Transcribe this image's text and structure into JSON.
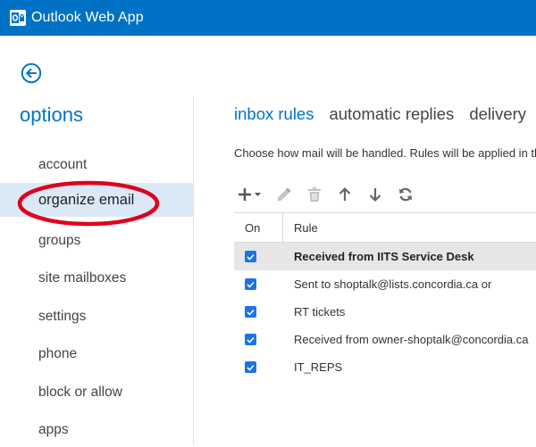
{
  "app": {
    "title": "Outlook Web App"
  },
  "sidebar": {
    "title": "options",
    "items": [
      {
        "label": "account"
      },
      {
        "label": "organize email",
        "selected": true
      },
      {
        "label": "groups"
      },
      {
        "label": "site mailboxes"
      },
      {
        "label": "settings"
      },
      {
        "label": "phone"
      },
      {
        "label": "block or allow"
      },
      {
        "label": "apps"
      }
    ]
  },
  "tabs": [
    {
      "label": "inbox rules",
      "active": true
    },
    {
      "label": "automatic replies"
    },
    {
      "label": "delivery"
    }
  ],
  "description": "Choose how mail will be handled. Rules will be applied in th",
  "toolbar": {
    "icons": [
      "add-icon",
      "edit-icon",
      "delete-icon",
      "move-up-icon",
      "move-down-icon",
      "refresh-icon"
    ]
  },
  "rules_table": {
    "columns": [
      "On",
      "Rule"
    ],
    "rows": [
      {
        "name": "Received from IITS Service Desk",
        "on": true,
        "selected": true
      },
      {
        "name": "Sent to shoptalk@lists.concordia.ca or",
        "on": true
      },
      {
        "name": "RT tickets",
        "on": true
      },
      {
        "name": "Received from owner-shoptalk@concordia.ca",
        "on": true
      },
      {
        "name": "IT_REPS",
        "on": true
      }
    ]
  },
  "colors": {
    "brand_blue": "#0072c6",
    "selected_nav_bg": "#dbe9f7",
    "highlight_ring": "#e0001b",
    "checkbox_blue": "#1a73e8"
  }
}
